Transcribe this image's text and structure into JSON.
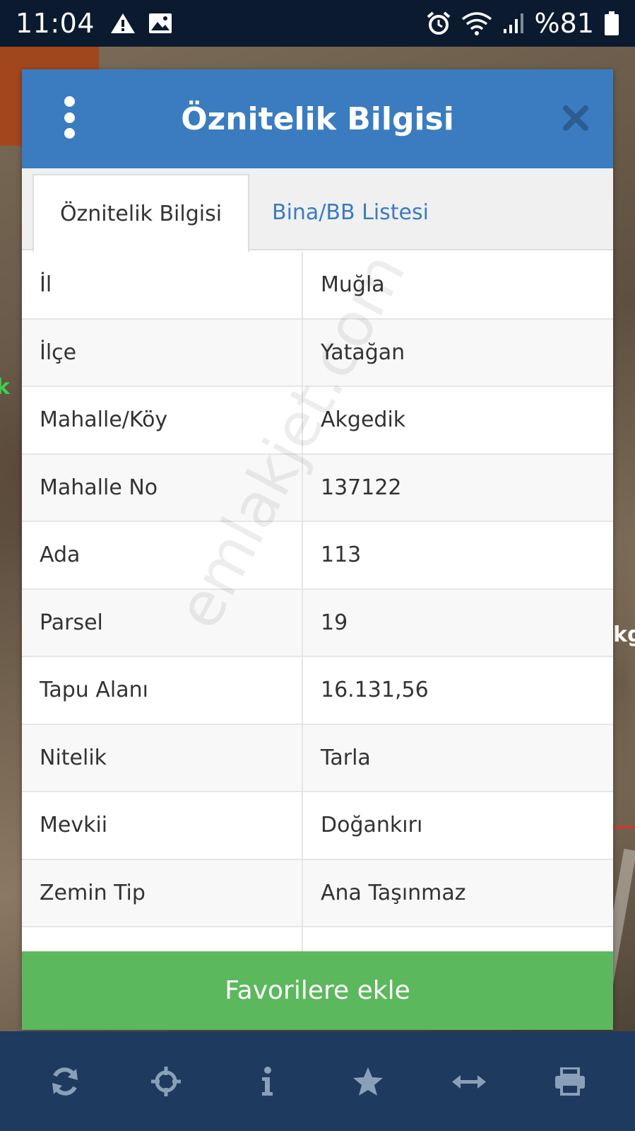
{
  "status_bar": {
    "time": "11:04",
    "battery": "%81",
    "icons": [
      "warning-icon",
      "image-icon",
      "alarm-icon",
      "wifi-icon",
      "signal-icon",
      "battery-icon"
    ]
  },
  "map": {
    "label_left": "k",
    "label_right": "kg"
  },
  "dialog": {
    "title": "Öznitelik Bilgisi",
    "menu_icon": "more-vertical-icon",
    "close_icon": "close-icon",
    "tabs": [
      {
        "label": "Öznitelik Bilgisi",
        "active": true
      },
      {
        "label": "Bina/BB Listesi",
        "active": false
      }
    ],
    "rows": [
      {
        "key": "İl",
        "value": "Muğla"
      },
      {
        "key": "İlçe",
        "value": "Yatağan"
      },
      {
        "key": "Mahalle/Köy",
        "value": "Akgedik"
      },
      {
        "key": "Mahalle No",
        "value": "137122"
      },
      {
        "key": "Ada",
        "value": "113"
      },
      {
        "key": "Parsel",
        "value": "19"
      },
      {
        "key": "Tapu Alanı",
        "value": "16.131,56"
      },
      {
        "key": "Nitelik",
        "value": "Tarla"
      },
      {
        "key": "Mevkii",
        "value": "Doğankırı"
      },
      {
        "key": "Zemin Tip",
        "value": "Ana Taşınmaz"
      },
      {
        "key": "",
        "value": ""
      }
    ],
    "watermark": "emlakjet.com",
    "favorite_button": "Favorilere ekle"
  },
  "toolbar": {
    "items": [
      "refresh-icon",
      "crosshair-icon",
      "info-icon",
      "star-icon",
      "measure-icon",
      "print-icon"
    ]
  },
  "colors": {
    "header": "#3a7cbf",
    "tab_link": "#3a7cbf",
    "favorite_button": "#5cb85c",
    "toolbar": "#1e3a5f",
    "toolbar_icon": "#8aa0b8",
    "status_bar": "#0b1a2e"
  }
}
